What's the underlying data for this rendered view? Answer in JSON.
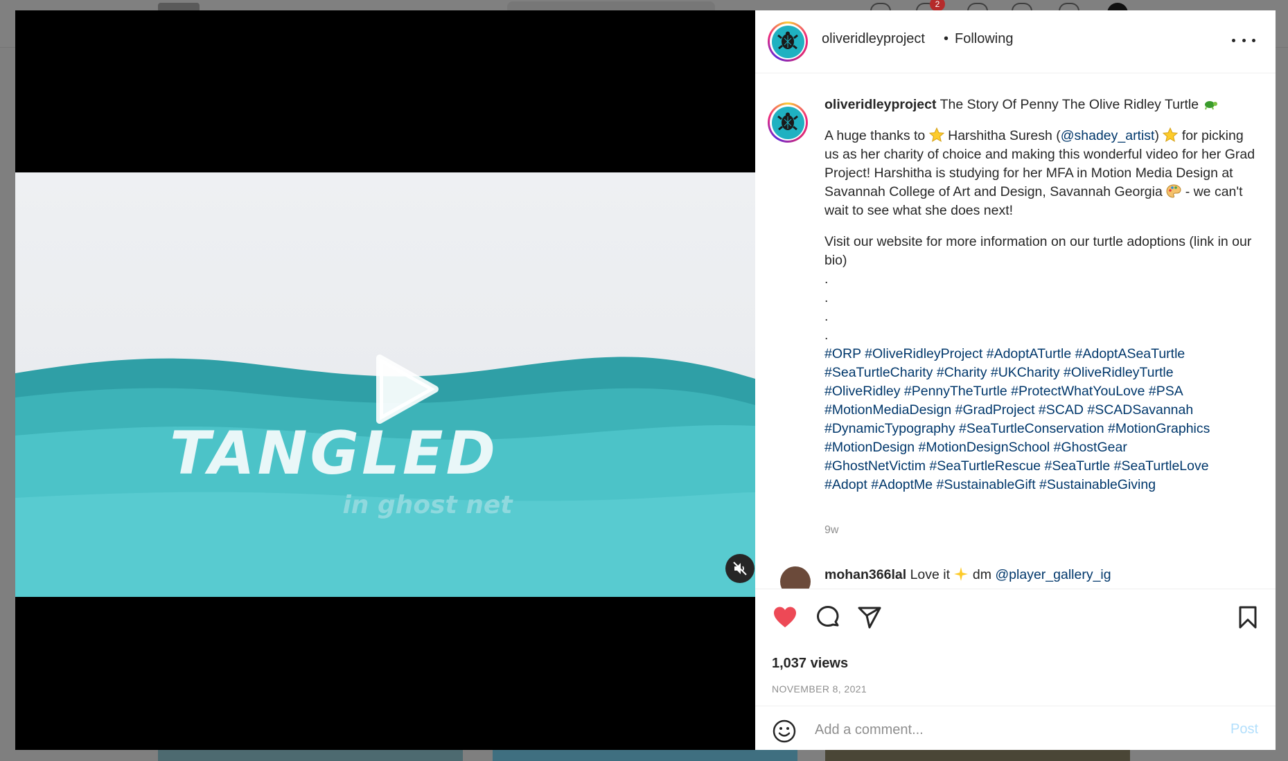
{
  "background": {
    "notification_count": "2"
  },
  "video": {
    "title_text": "TANGLED",
    "subtitle_text": "in ghost net",
    "play_icon": "play-icon",
    "mute_icon": "muted-speaker-icon"
  },
  "post": {
    "username": "oliveridleyproject",
    "separator": "•",
    "follow_status": "Following",
    "more_icon": "more-horizontal-icon",
    "caption": {
      "username": "oliveridleyproject",
      "title": "The Story Of Penny The Olive Ridley Turtle",
      "title_emoji": "turtle-emoji",
      "thanks_before": "A huge thanks to",
      "thanks_name": "Harshitha Suresh (",
      "mention": "@shadey_artist",
      "thanks_close": ")",
      "body_after_star": "for picking us as her charity of choice and making this wonderful video for her Grad Project! Harshitha is studying for her MFA in Motion Media Design at Savannah College of Art and Design, Savannah Georgia",
      "body_end": "- we can't wait to see what she does next!",
      "website_line": "Visit our website for more information on our turtle adoptions (link in our bio)",
      "dots": [
        ".",
        ".",
        ".",
        "."
      ],
      "hashtag_lines": [
        "#ORP #OliveRidleyProject #AdoptATurtle #AdoptASeaTurtle",
        "#SeaTurtleCharity #Charity #UKCharity #OliveRidleyTurtle",
        "#OliveRidley #PennyTheTurtle #ProtectWhatYouLove #PSA",
        "#MotionMediaDesign #GradProject #SCAD #SCADSavannah",
        "#DynamicTypography #SeaTurtleConservation #MotionGraphics",
        "#MotionDesign #MotionDesignSchool #GhostGear",
        "#GhostNetVictim #SeaTurtleRescue #SeaTurtle #SeaTurtleLove",
        "#Adopt #AdoptMe #SustainableGift #SustainableGiving"
      ],
      "time": "9w"
    },
    "comment": {
      "username": "mohan366lal",
      "text": "Love it",
      "text2": "dm",
      "mention": "@player_gallery_ig"
    },
    "actions": {
      "like_icon": "heart-filled-icon",
      "comment_icon": "comment-bubble-icon",
      "share_icon": "paper-plane-icon",
      "save_icon": "bookmark-icon",
      "like_color": "#ed4956"
    },
    "views": "1,037 views",
    "date": "NOVEMBER 8, 2021",
    "add_comment": {
      "emoji_icon": "smiley-icon",
      "placeholder": "Add a comment...",
      "post_label": "Post"
    }
  }
}
